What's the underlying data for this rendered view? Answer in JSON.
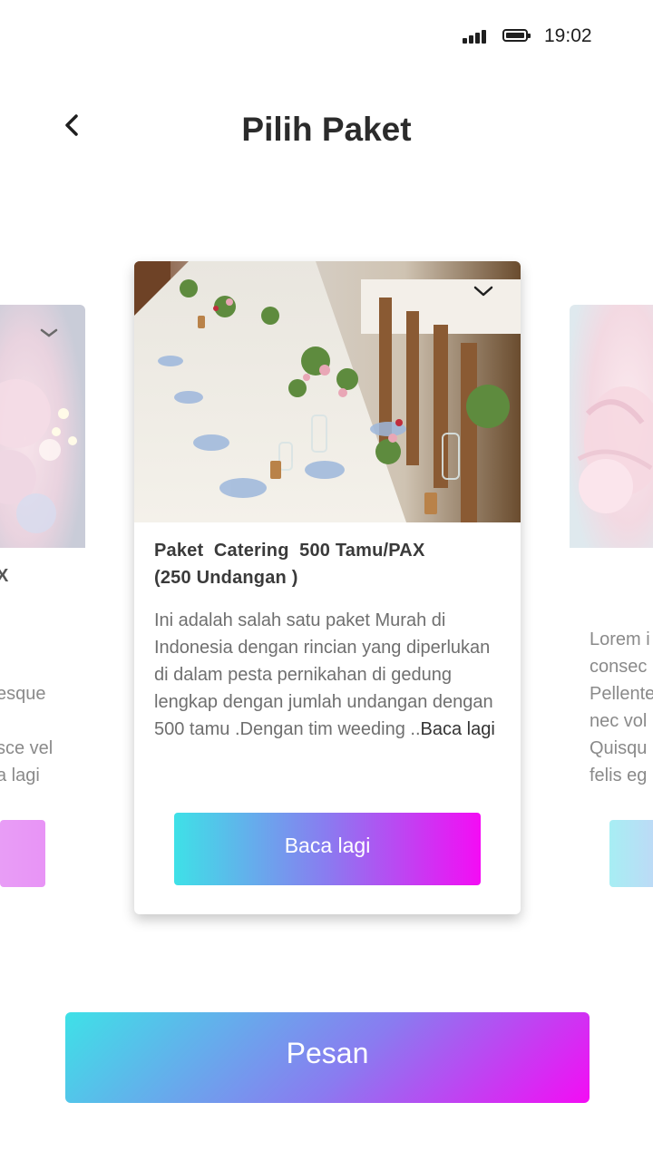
{
  "status_bar": {
    "time": "19:02"
  },
  "header": {
    "title": "Pilih Paket",
    "back_icon": "chevron-left-icon"
  },
  "main_card": {
    "title_line1": "Paket  Catering  500 Tamu/PAX",
    "title_line2": "(250 Undangan )",
    "description": "Ini adalah salah satu paket Murah di Indonesia dengan rincian yang diperlukan di dalam pesta pernikahan di gedung lengkap dengan jumlah undangan dengan 500 tamu .Dengan tim weeding ..",
    "read_more_inline": "Baca lagi",
    "button_label": "Baca lagi",
    "image_icon": "chevron-down-icon"
  },
  "left_card": {
    "title_fragment": "X",
    "text_lines": [
      "esque",
      "",
      "sce vel",
      "a lagi"
    ]
  },
  "right_card": {
    "text_lines": [
      "Lorem i",
      "consec",
      "Pellente",
      "nec vol",
      "Quisqu",
      "felis eg"
    ]
  },
  "footer": {
    "button_label": "Pesan"
  },
  "colors": {
    "gradient_start": "#3ee1e7",
    "gradient_mid": "#8a7bf0",
    "gradient_end": "#f40cf4",
    "title_text": "#2b2b2b",
    "body_text": "#6f6f6f"
  }
}
